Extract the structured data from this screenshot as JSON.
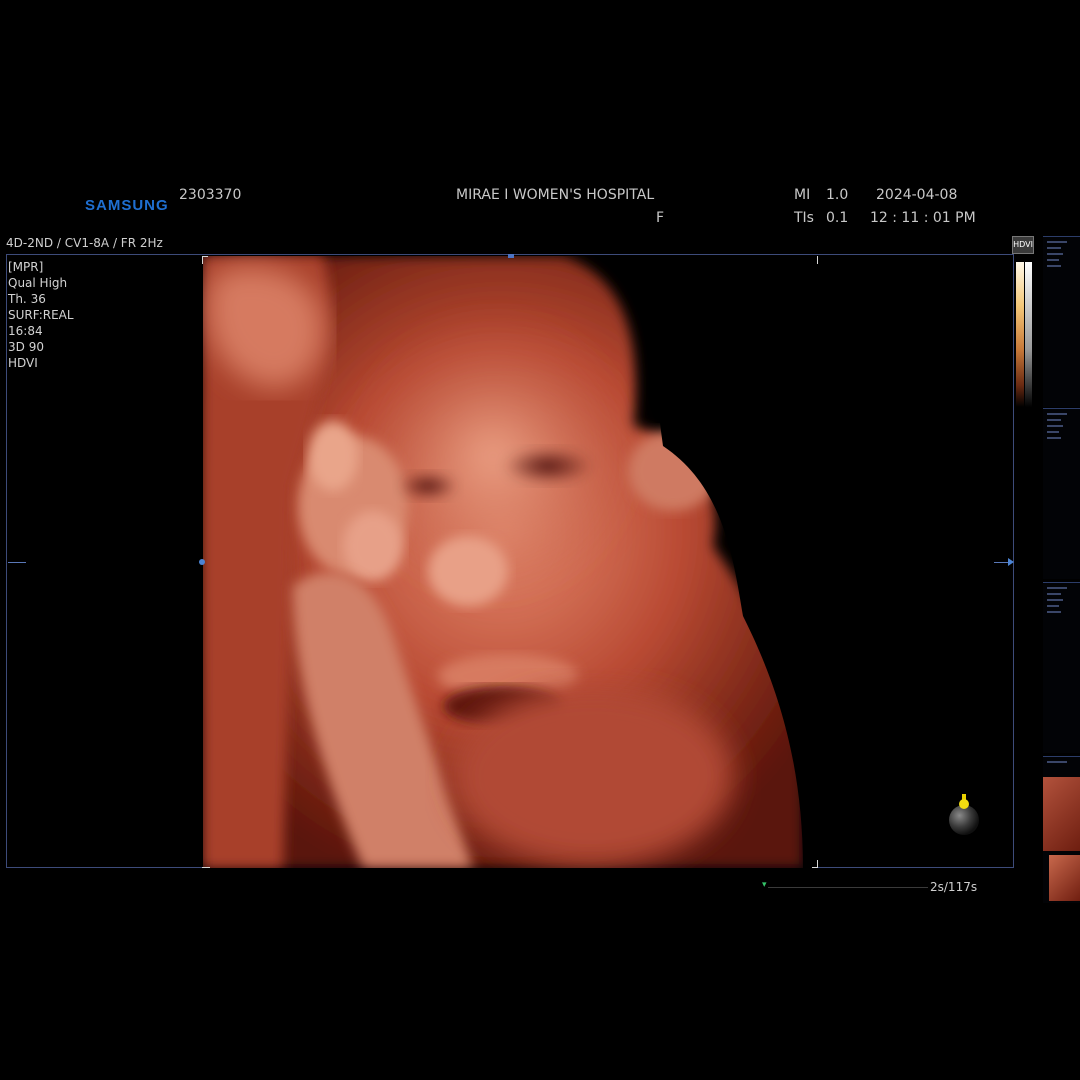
{
  "header": {
    "brand": "SAMSUNG",
    "patient_id": "2303370",
    "hospital": "MIRAE I WOMEN'S HOSPITAL",
    "sex": "F",
    "mi_label": "MI",
    "mi_value": "1.0",
    "tis_label": "TIs",
    "tis_value": "0.1",
    "date": "2024-04-08",
    "time": "12 : 11 : 01 PM"
  },
  "mode_line": "4D-2ND / CV1-8A / FR 2Hz",
  "params": [
    "[MPR]",
    "Qual High",
    "Th. 36",
    "SURF:REAL",
    "16:84",
    "3D 90",
    "HDVI"
  ],
  "colorbar_label": "HDVI",
  "cine": {
    "counter": "2s/117s"
  },
  "colors": {
    "brand": "#1f6fd1",
    "frame": "#3d4b7a",
    "render_tint": "#c0543a"
  },
  "icons": {
    "probe": "probe-orientation-icon",
    "cine_marker": "cine-marker-icon"
  }
}
